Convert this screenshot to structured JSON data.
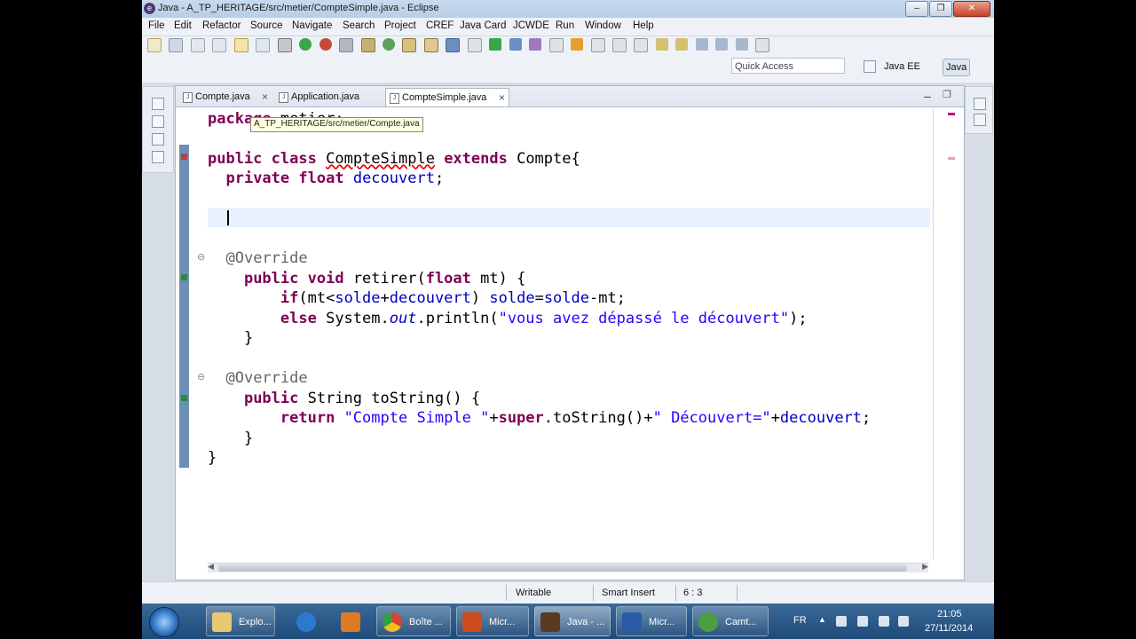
{
  "window": {
    "title": "Java - A_TP_HERITAGE/src/metier/CompteSimple.java - Eclipse",
    "controls": [
      "minimize",
      "restore",
      "close"
    ]
  },
  "menu": [
    "File",
    "Edit",
    "Refactor",
    "Source",
    "Navigate",
    "Search",
    "Project",
    "CREF",
    "Java Card",
    "JCWDE",
    "Run",
    "Window",
    "Help"
  ],
  "quick_access": {
    "placeholder": "Quick Access"
  },
  "perspectives": [
    {
      "label": "Java EE",
      "active": false
    },
    {
      "label": "Java",
      "active": true
    }
  ],
  "editor": {
    "tabs": [
      {
        "label": "Compte.java",
        "active": false,
        "closable": true
      },
      {
        "label": "Application.java",
        "active": false,
        "closable": false
      },
      {
        "label": "CompteSimple.java",
        "active": true,
        "closable": true
      }
    ],
    "tooltip": "A_TP_HERITAGE/src/metier/Compte.java",
    "code_lines": [
      "package metier;",
      "",
      "public class CompteSimple extends Compte{",
      "  private float decouvert;",
      "",
      "",
      "",
      "  @Override",
      "    public void retirer(float mt) {",
      "        if(mt<solde+decouvert) solde=solde-mt;",
      "        else System.out.println(\"vous avez dépassé le découvert\");",
      "    }",
      "",
      "  @Override",
      "    public String toString() {",
      "        return \"Compte Simple \"+super.toString()+\" Découvert=\"+decouvert;",
      "    }",
      "}"
    ]
  },
  "status": {
    "writable": "Writable",
    "insert_mode": "Smart Insert",
    "position": "6 : 3"
  },
  "taskbar": {
    "items": [
      {
        "label": "Explo...",
        "icon": "folder-icon"
      },
      {
        "label": "",
        "icon": "internet-explorer-icon"
      },
      {
        "label": "",
        "icon": "media-player-icon"
      },
      {
        "label": "Boîte ...",
        "icon": "chrome-icon"
      },
      {
        "label": "Micr...",
        "icon": "powerpoint-icon"
      },
      {
        "label": "Java - ...",
        "icon": "eclipse-icon"
      },
      {
        "label": "Micr...",
        "icon": "word-icon"
      },
      {
        "label": "Camt...",
        "icon": "camtasia-icon"
      }
    ],
    "language": "FR",
    "time": "21:05",
    "date": "27/11/2014"
  },
  "colors": {
    "keyword": "#7f0055",
    "string": "#2a00ff",
    "field": "#0000c0",
    "annotation": "#646464",
    "current_line": "#e8f2fe"
  }
}
